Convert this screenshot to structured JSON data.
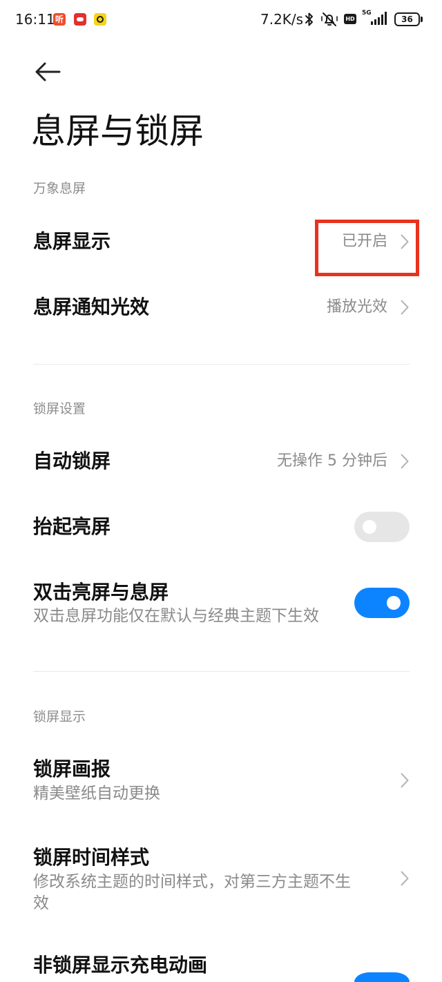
{
  "status_bar": {
    "time": "16:11",
    "notification_icons": [
      {
        "name": "ting-app-icon",
        "glyph": "听",
        "color": "#ee4e2c"
      },
      {
        "name": "red-app-icon",
        "color": "#e1312c"
      },
      {
        "name": "yellow-app-icon",
        "color": "#f6d31a"
      }
    ],
    "net_speed": "7.2K/s",
    "bluetooth_icon": "bluetooth-icon",
    "mute_icon": "mute-icon",
    "hd_badge": "HD",
    "network_type": "5G",
    "signal_icon": "signal-icon",
    "battery_level": "36"
  },
  "header": {
    "back_icon": "back-arrow-icon",
    "title": "息屏与锁屏"
  },
  "sections": [
    {
      "title": "万象息屏",
      "items": [
        {
          "label": "息屏显示",
          "value": "已开启",
          "chevron_icon": "chevron-right-icon",
          "highlighted": true
        },
        {
          "label": "息屏通知光效",
          "value": "播放光效",
          "chevron_icon": "chevron-right-icon"
        }
      ]
    },
    {
      "title": "锁屏设置",
      "items": [
        {
          "label": "自动锁屏",
          "value": "无操作 5 分钟后",
          "chevron_icon": "chevron-right-icon"
        },
        {
          "label": "抬起亮屏",
          "toggle_on": false
        },
        {
          "label": "双击亮屏与息屏",
          "subtitle": "双击息屏功能仅在默认与经典主题下生效",
          "toggle_on": true
        }
      ]
    },
    {
      "title": "锁屏显示",
      "items": [
        {
          "label": "锁屏画报",
          "subtitle": "精美壁纸自动更换",
          "chevron_icon": "chevron-right-icon"
        },
        {
          "label": "锁屏时间样式",
          "subtitle": "修改系统主题的时间样式，对第三方主题不生效",
          "chevron_icon": "chevron-right-icon"
        },
        {
          "label": "非锁屏显示充电动画",
          "toggle_on": true
        }
      ]
    }
  ],
  "colors": {
    "accent": "#0d84ff",
    "toggle_off": "#e6e6e6",
    "highlight_box": "#e8321f",
    "secondary_text": "#8a8a8a",
    "divider": "#e8e8e8"
  }
}
